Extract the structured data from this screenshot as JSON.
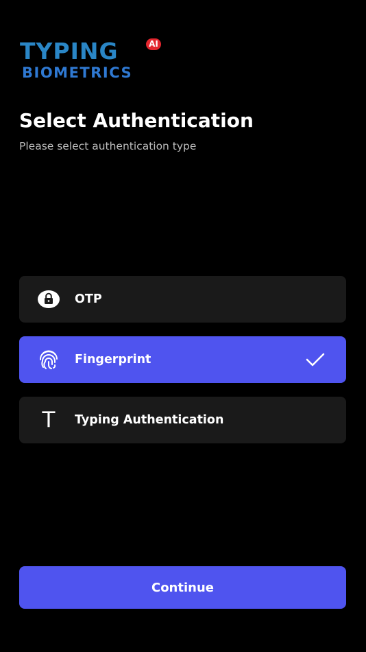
{
  "logo": {
    "line1": "TYPING",
    "line2": "BIOMETRICS",
    "badge": "AI",
    "colors": {
      "primary": "#2a86c6",
      "secondary": "#2f79d2",
      "badge": "#e3262e"
    }
  },
  "header": {
    "title": "Select Authentication",
    "subtitle": "Please select authentication type"
  },
  "options": [
    {
      "label": "OTP",
      "icon": "lock-icon",
      "selected": false
    },
    {
      "label": "Fingerprint",
      "icon": "fingerprint-icon",
      "selected": true
    },
    {
      "label": "Typing Authentication",
      "icon": "text-t-icon",
      "glyph": "T",
      "selected": false
    }
  ],
  "selection_icon": "checkmark-icon",
  "continue_label": "Continue",
  "colors": {
    "background": "#000000",
    "card": "#1a1a1a",
    "accent": "#4f54ef",
    "subtitle": "#bdbdbd"
  }
}
